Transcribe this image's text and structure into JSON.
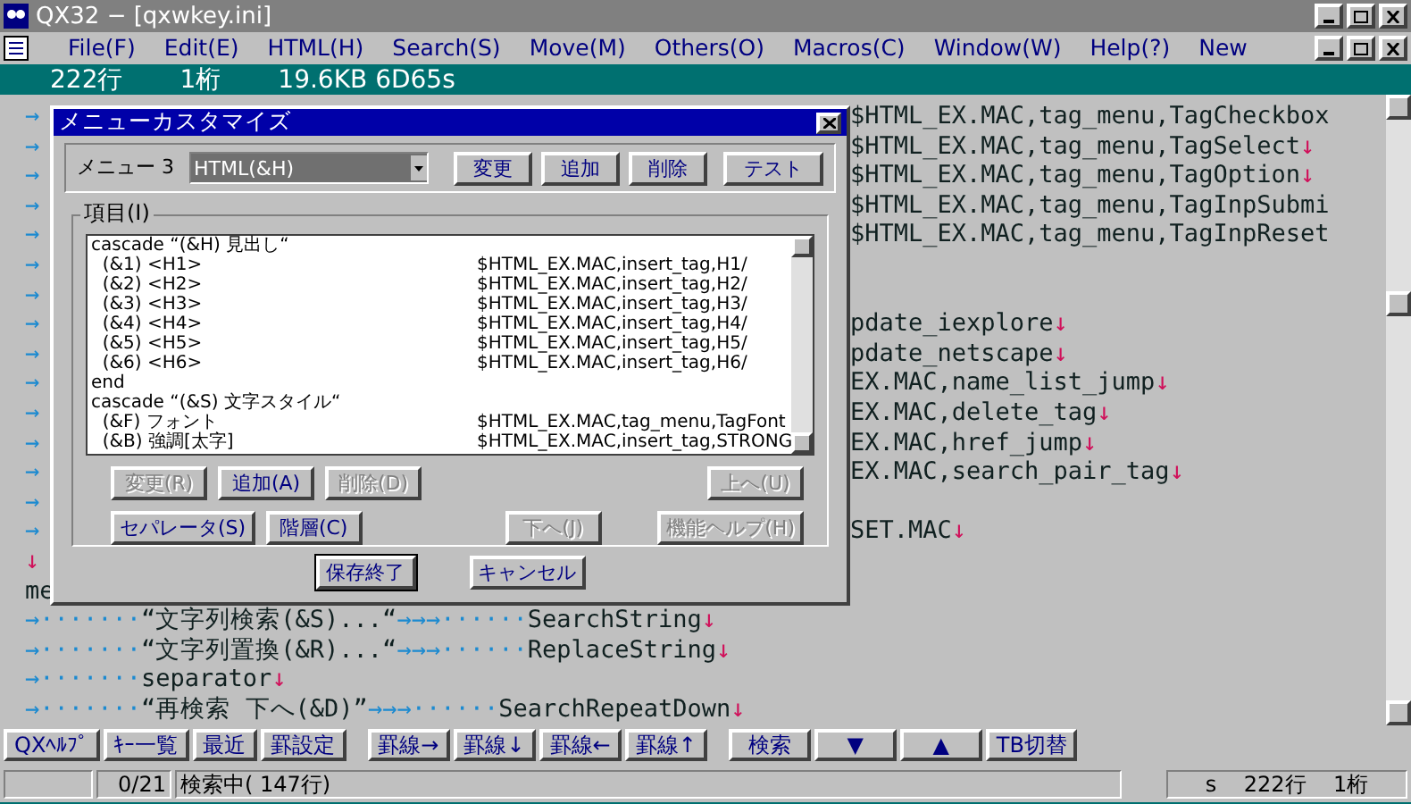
{
  "window": {
    "title": "QX32 − [qxwkey.ini]"
  },
  "menu": [
    "File(F)",
    "Edit(E)",
    "HTML(H)",
    "Search(S)",
    "Move(M)",
    "Others(O)",
    "Macros(C)",
    "Window(W)",
    "Help(?)",
    "New"
  ],
  "info_bar": {
    "line": "222行",
    "column": "1桁",
    "size": "19.6KB 6D65s"
  },
  "editor_lines": [
    {
      "kind": "split",
      "left": "→",
      "right": "$HTML_EX.MAC,tag_menu,TagCheckbox"
    },
    {
      "kind": "split",
      "left": "→",
      "right": "$HTML_EX.MAC,tag_menu,TagSelect↓"
    },
    {
      "kind": "split",
      "left": "→",
      "right": "$HTML_EX.MAC,tag_menu,TagOption↓"
    },
    {
      "kind": "split",
      "left": "→",
      "right": "$HTML_EX.MAC,tag_menu,TagInpSubmi"
    },
    {
      "kind": "split",
      "left": "→",
      "right": "$HTML_EX.MAC,tag_menu,TagInpReset"
    },
    {
      "kind": "split",
      "left": "→"
    },
    {
      "kind": "split",
      "left": "→"
    },
    {
      "kind": "split",
      "left": "→",
      "right": "pdate_iexplore↓"
    },
    {
      "kind": "split",
      "left": "→",
      "right": "pdate_netscape↓"
    },
    {
      "kind": "split",
      "left": "→",
      "right": "EX.MAC,name_list_jump↓"
    },
    {
      "kind": "split",
      "left": "→",
      "right": "EX.MAC,delete_tag↓"
    },
    {
      "kind": "split",
      "left": "→",
      "right": "EX.MAC,href_jump↓"
    },
    {
      "kind": "split",
      "left": "→",
      "right": "EX.MAC,search_pair_tag↓"
    },
    {
      "kind": "split",
      "left": "→"
    },
    {
      "kind": "split",
      "left": "→",
      "right": "SET.MAC↓"
    },
    {
      "kind": "split",
      "left": "↓"
    },
    {
      "kind": "split",
      "left": "me"
    },
    {
      "kind": "full",
      "text": "→·······“文字列検索(&S)...“→→→······SearchString↓"
    },
    {
      "kind": "full",
      "text": "→·······“文字列置換(&R)...“→→→······ReplaceString↓"
    },
    {
      "kind": "full",
      "text": "→·······separator↓"
    },
    {
      "kind": "full",
      "text": "→·······“再検索 下へ(&D)”→→→······SearchRepeatDown↓"
    }
  ],
  "dialog": {
    "title": "メニューカスタマイズ",
    "menu_label": "メニュー 3",
    "menu_select": "HTML(&H)",
    "top_buttons": [
      "変更",
      "追加",
      "削除",
      "テスト"
    ],
    "group_label": "項目(I)",
    "items": [
      {
        "left": "cascade “(&H) 見出し“"
      },
      {
        "left": "  (&1) <H1>",
        "right": "$HTML_EX.MAC,insert_tag,H1/"
      },
      {
        "left": "  (&2) <H2>",
        "right": "$HTML_EX.MAC,insert_tag,H2/"
      },
      {
        "left": "  (&3) <H3>",
        "right": "$HTML_EX.MAC,insert_tag,H3/"
      },
      {
        "left": "  (&4) <H4>",
        "right": "$HTML_EX.MAC,insert_tag,H4/"
      },
      {
        "left": "  (&5) <H5>",
        "right": "$HTML_EX.MAC,insert_tag,H5/"
      },
      {
        "left": "  (&6) <H6>",
        "right": "$HTML_EX.MAC,insert_tag,H6/"
      },
      {
        "left": "end"
      },
      {
        "left": "cascade “(&S) 文字スタイル“"
      },
      {
        "left": "  (&F) フォント",
        "right": "$HTML_EX.MAC,tag_menu,TagFont"
      },
      {
        "left": "  (&B) 強調[太字]",
        "right": "$HTML_EX.MAC,insert_tag,STRONG"
      }
    ],
    "buttons_row1": [
      {
        "label": "変更(R)",
        "disabled": true
      },
      {
        "label": "追加(A)",
        "disabled": false
      },
      {
        "label": "削除(D)",
        "disabled": true
      },
      {
        "label": "上へ(U)",
        "disabled": true
      }
    ],
    "buttons_row2": [
      {
        "label": "セパレータ(S)",
        "disabled": false
      },
      {
        "label": "階層(C)",
        "disabled": false
      },
      {
        "label": "下へ(J)",
        "disabled": true
      },
      {
        "label": "機能ヘルプ(H)",
        "disabled": true
      }
    ],
    "ok": "保存終了",
    "cancel": "キャンセル"
  },
  "toolbar": [
    "QXﾍﾙﾌﾟ",
    "ｷｰ一覧",
    "最近",
    "罫設定",
    "罫線→",
    "罫線↓",
    "罫線←",
    "罫線↑",
    "検索",
    "▼",
    "▲",
    "TB切替"
  ],
  "status_bar": {
    "count": "0/21",
    "message": "検索中( 147行)",
    "position": "s    222行    1桁"
  }
}
